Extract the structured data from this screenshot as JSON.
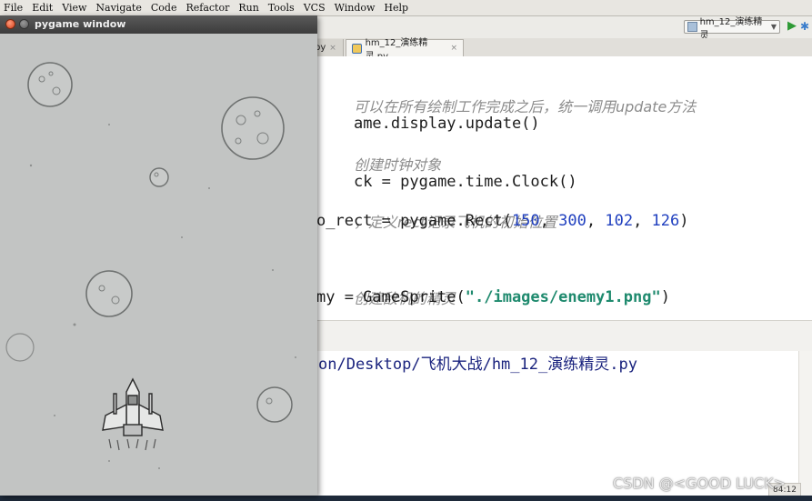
{
  "menubar": {
    "items": [
      "File",
      "Edit",
      "View",
      "Navigate",
      "Code",
      "Refactor",
      "Run",
      "Tools",
      "VCS",
      "Window",
      "Help"
    ]
  },
  "toolbar": {
    "run_config_label": "hm_12_演练精灵",
    "run_icon": "play-icon",
    "debug_icon": "bug-icon"
  },
  "tabs": {
    "previous_tab_label": "py",
    "active_tab_label": "hm_12_演练精灵.py",
    "close_glyph": "×"
  },
  "editor": {
    "lines": [
      {
        "comment": "可以在所有绘制工作完成之后，统一调用update方法"
      },
      {
        "code": "ame.display.update()"
      },
      {
        "comment": "创建时钟对象"
      },
      {
        "code": "ck = pygame.time.Clock()"
      },
      {
        "comment": "，定义rect记录飞机的初始位置"
      },
      {
        "code_prefix": "o_rect = pygame.Rect(",
        "n1": "150",
        "n2": "300",
        "n3": "102",
        "n4": "126",
        "code_suffix": ")"
      },
      {
        "comment": "创建敌机的精灵"
      },
      {
        "code_prefix": "my = GameSprite(",
        "string": "\"./images/enemy1.png\"",
        "code_suffix": ")"
      }
    ]
  },
  "console": {
    "path_line": "on/Desktop/飞机大战/hm_12_演练精灵.py"
  },
  "statusbar": {
    "clock": "84:12"
  },
  "watermark": "CSDN @<GOOD LUCK>",
  "pygame_window": {
    "title": "pygame window",
    "background_color": "#c2c4c3"
  },
  "colors": {
    "number": "#1f3fbf",
    "string": "#1f8a6e",
    "comment": "#8c8c8c"
  }
}
